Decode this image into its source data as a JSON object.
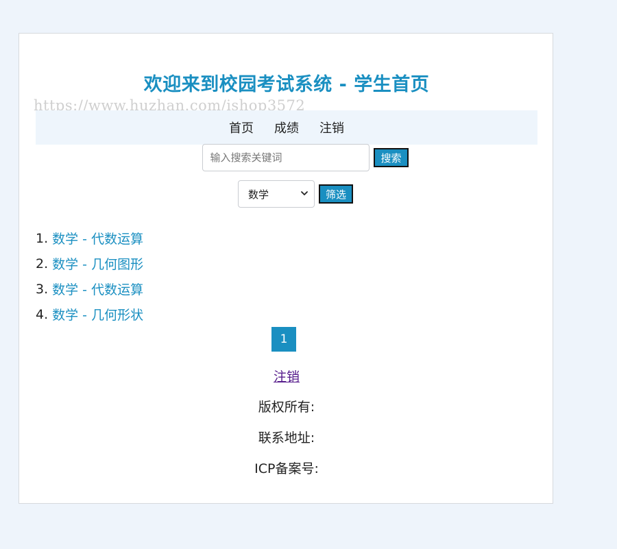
{
  "header": {
    "title": "欢迎来到校园考试系统 - 学生首页",
    "watermark": "https://www.huzhan.com/ishop3572"
  },
  "nav": {
    "items": [
      {
        "label": "首页"
      },
      {
        "label": "成绩"
      },
      {
        "label": "注销"
      }
    ]
  },
  "search": {
    "placeholder": "输入搜索关键词",
    "value": "",
    "button_label": "搜索"
  },
  "filter": {
    "selected": "数学",
    "button_label": "筛选"
  },
  "exams": [
    {
      "number": "1.",
      "title": "数学 - 代数运算"
    },
    {
      "number": "2.",
      "title": "数学 - 几何图形"
    },
    {
      "number": "3.",
      "title": "数学 - 代数运算"
    },
    {
      "number": "4.",
      "title": "数学 - 几何形状"
    }
  ],
  "pagination": {
    "current_page": "1"
  },
  "logout_link": "注销",
  "footer": {
    "copyright": "版权所有:",
    "address": "联系地址:",
    "icp": "ICP备案号:"
  },
  "colors": {
    "accent": "#1a8fc1",
    "page_bg": "#eef4fb",
    "nav_bg": "#eef5fc",
    "visited_link": "#551a8b"
  }
}
